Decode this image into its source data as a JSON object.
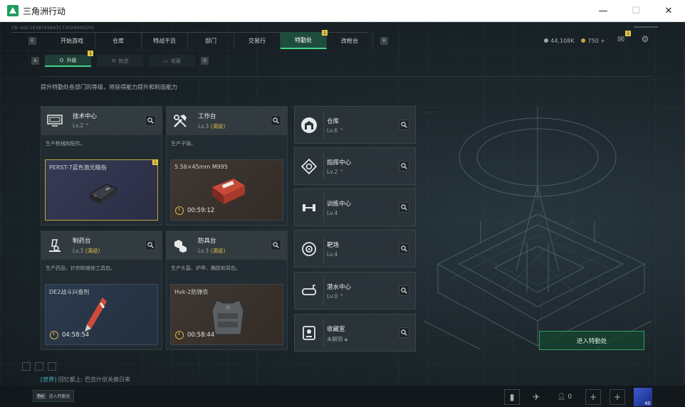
{
  "window": {
    "title": "三角洲行动",
    "minimize": "—",
    "maximize": "☐",
    "close": "✕"
  },
  "uid": "CN UID:1638765643173026000200",
  "nav": {
    "left_key": "E",
    "right_key": "R",
    "tabs": [
      {
        "label": "开始游戏",
        "active": false
      },
      {
        "label": "仓库",
        "active": false
      },
      {
        "label": "特战干员",
        "active": false
      },
      {
        "label": "部门",
        "active": false
      },
      {
        "label": "交易行",
        "active": false
      },
      {
        "label": "特勤处",
        "active": true,
        "badge": "1"
      },
      {
        "label": "改枪台",
        "active": false
      }
    ]
  },
  "currency": {
    "silver": "44,108K",
    "gold": "750 +"
  },
  "top_icons": {
    "mail_badge": "1"
  },
  "subnav": {
    "left_key": "A",
    "right_key": "D",
    "tabs": [
      {
        "label": "升级",
        "active": true,
        "badge": "1"
      },
      {
        "label": "制造",
        "active": false
      },
      {
        "label": "收藏",
        "active": false
      }
    ]
  },
  "description": "提升特勤处各部门的等级，将获得能力提升和制造能力",
  "facilities": [
    {
      "title": "技术中心",
      "level": "Lv.2",
      "max": "",
      "desc": "生产枪械和配件。",
      "item": "PERST-7蓝色激光瞄指",
      "timer": "",
      "item_badge": "1"
    },
    {
      "title": "工作台",
      "level": "Lv.3",
      "max": "(满级)",
      "desc": "生产子弹。",
      "item": "5.56×45mm M995",
      "timer": "00:59:12",
      "item_badge": ""
    },
    {
      "title": "制药台",
      "level": "Lv.3",
      "max": "(满级)",
      "desc": "生产药品、针剂和维修工具包。",
      "item": "DE2战斗兴奋剂",
      "timer": "04:58:54",
      "item_badge": ""
    },
    {
      "title": "防具台",
      "level": "Lv.3",
      "max": "(满级)",
      "desc": "生产头盔、护甲、胸挂和背包。",
      "item": "Hvk-2防弹衣",
      "timer": "00:58:44",
      "item_badge": ""
    }
  ],
  "side_facilities": [
    {
      "title": "仓库",
      "level": "Lv.6"
    },
    {
      "title": "指挥中心",
      "level": "Lv.2"
    },
    {
      "title": "训练中心",
      "level": "Lv.4"
    },
    {
      "title": "靶场",
      "level": "Lv.4"
    },
    {
      "title": "潜水中心",
      "level": "Lv.0"
    },
    {
      "title": "收藏室",
      "level": "未解锁"
    }
  ],
  "enter_button": "进入特勤处",
  "chat": {
    "channel": "[世界]",
    "user": "回忆都上:",
    "text": "巴克什侦关换日来"
  },
  "esc": {
    "key": "Esc",
    "label": "进入特勤处"
  },
  "bottom": {
    "friends_count": "0",
    "avatar_level": "40"
  },
  "colors": {
    "accent": "#46d38a",
    "max_level": "#d2b24c",
    "badge": "#e4c547"
  }
}
